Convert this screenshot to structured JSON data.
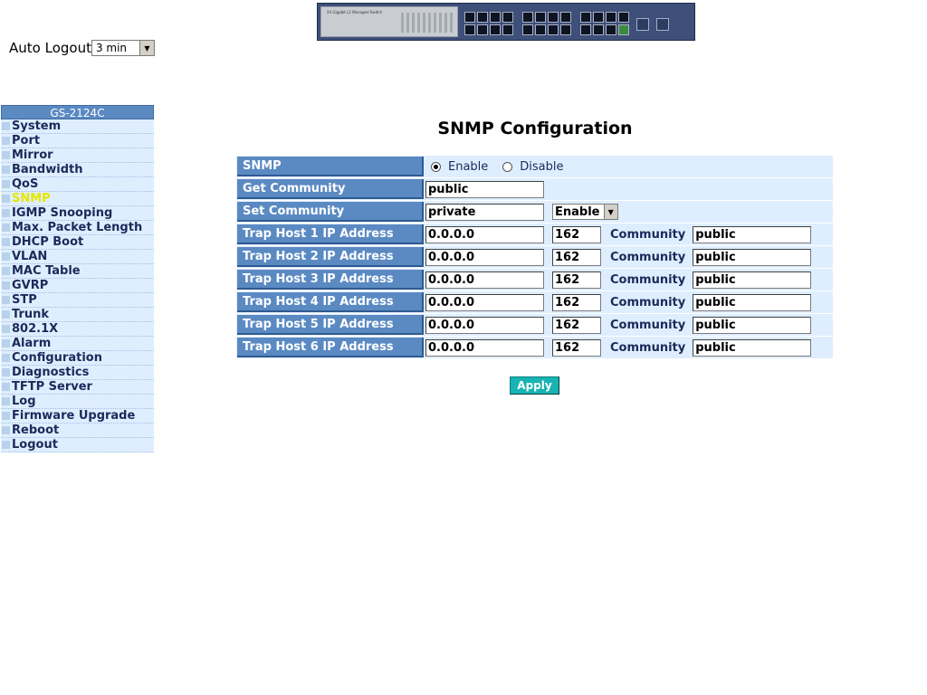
{
  "banner": {
    "brand_text": "24 Gigabit L2 Managed Switch"
  },
  "auto_logout": {
    "label": "Auto Logout",
    "selected": "3 min"
  },
  "sidebar": {
    "title": "GS-2124C",
    "active": "SNMP",
    "items": [
      {
        "label": "System"
      },
      {
        "label": "Port"
      },
      {
        "label": "Mirror"
      },
      {
        "label": "Bandwidth"
      },
      {
        "label": "QoS"
      },
      {
        "label": "SNMP"
      },
      {
        "label": "IGMP Snooping"
      },
      {
        "label": "Max. Packet Length"
      },
      {
        "label": "DHCP Boot"
      },
      {
        "label": "VLAN"
      },
      {
        "label": "MAC Table"
      },
      {
        "label": "GVRP"
      },
      {
        "label": "STP"
      },
      {
        "label": "Trunk"
      },
      {
        "label": "802.1X"
      },
      {
        "label": "Alarm"
      },
      {
        "label": "Configuration"
      },
      {
        "label": "Diagnostics"
      },
      {
        "label": "TFTP Server"
      },
      {
        "label": "Log"
      },
      {
        "label": "Firmware Upgrade"
      },
      {
        "label": "Reboot"
      },
      {
        "label": "Logout"
      }
    ]
  },
  "main": {
    "title": "SNMP Configuration",
    "snmp": {
      "label": "SNMP",
      "enable_label": "Enable",
      "disable_label": "Disable",
      "selected": "Enable"
    },
    "get_community": {
      "label": "Get Community",
      "value": "public"
    },
    "set_community": {
      "label": "Set Community",
      "value": "private",
      "mode": "Enable"
    },
    "community_label": "Community",
    "trap_hosts": [
      {
        "label": "Trap Host 1 IP Address",
        "ip": "0.0.0.0",
        "port": "162",
        "community": "public"
      },
      {
        "label": "Trap Host 2 IP Address",
        "ip": "0.0.0.0",
        "port": "162",
        "community": "public"
      },
      {
        "label": "Trap Host 3 IP Address",
        "ip": "0.0.0.0",
        "port": "162",
        "community": "public"
      },
      {
        "label": "Trap Host 4 IP Address",
        "ip": "0.0.0.0",
        "port": "162",
        "community": "public"
      },
      {
        "label": "Trap Host 5 IP Address",
        "ip": "0.0.0.0",
        "port": "162",
        "community": "public"
      },
      {
        "label": "Trap Host 6 IP Address",
        "ip": "0.0.0.0",
        "port": "162",
        "community": "public"
      }
    ],
    "apply_label": "Apply"
  }
}
